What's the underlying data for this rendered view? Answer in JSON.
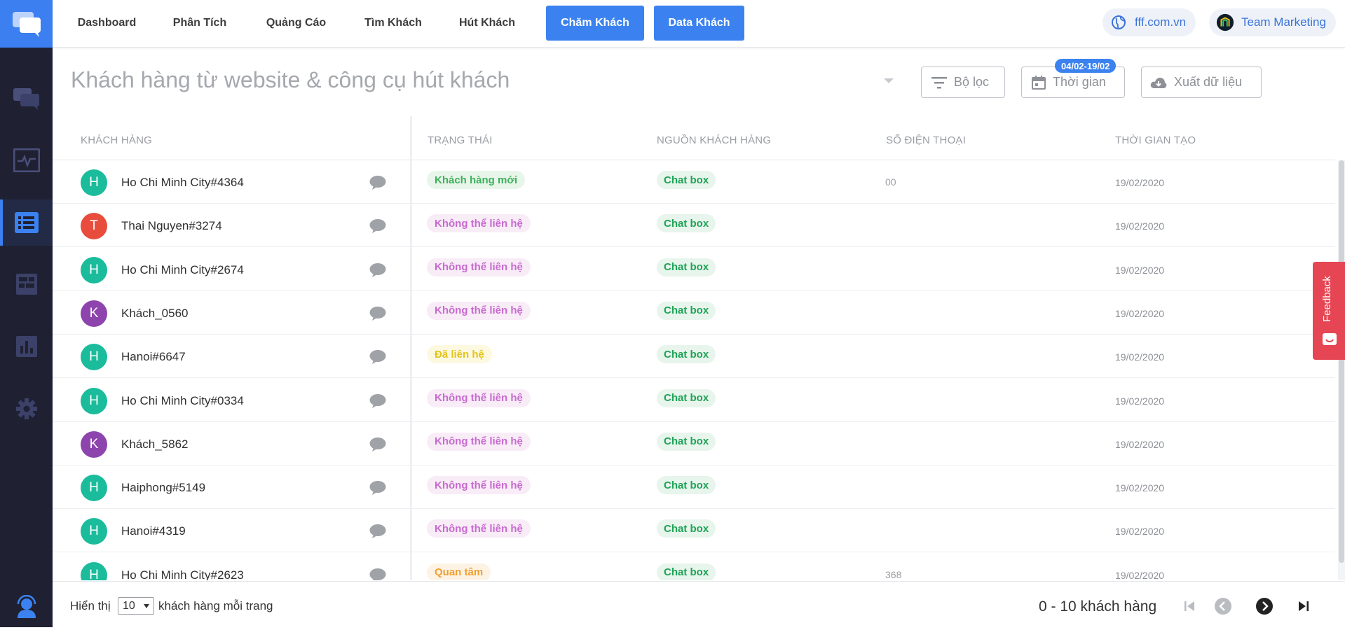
{
  "nav": {
    "tabs": [
      {
        "label": "Dashboard"
      },
      {
        "label": "Phân Tích"
      },
      {
        "label": "Quảng Cáo"
      },
      {
        "label": "Tìm Khách"
      },
      {
        "label": "Hút Khách"
      },
      {
        "label": "Chăm Khách"
      },
      {
        "label": "Data Khách"
      }
    ],
    "domain": "fff.com.vn",
    "team": "Team Marketing"
  },
  "sidebar": {
    "items": [
      {
        "icon": "chat-bubbles-icon"
      },
      {
        "icon": "activity-monitor-icon"
      },
      {
        "icon": "list-icon",
        "active": true
      },
      {
        "icon": "layout-icon"
      },
      {
        "icon": "bar-chart-icon"
      },
      {
        "icon": "gear-icon"
      }
    ],
    "bottom_icon": "support-agent-icon"
  },
  "header": {
    "title": "Khách hàng từ website & công cụ hút khách",
    "filter_label": "Bộ lọc",
    "time_label": "Thời gian",
    "date_range": "04/02-19/02",
    "export_label": "Xuất dữ liệu"
  },
  "table": {
    "columns": [
      "KHÁCH HÀNG",
      "TRẠNG THÁI",
      "NGUỒN KHÁCH HÀNG",
      "SỐ ĐIỆN THOẠI",
      "THỜI GIAN TẠO"
    ],
    "rows": [
      {
        "initial": "H",
        "avatar_color": "#1abc9c",
        "name": "Ho Chi Minh City#4364",
        "status": "Khách hàng mới",
        "status_type": "new",
        "source": "Chat box",
        "phone": "00",
        "created": "19/02/2020"
      },
      {
        "initial": "T",
        "avatar_color": "#e74c3c",
        "name": "Thai Nguyen#3274",
        "status": "Không thể liên hệ",
        "status_type": "unreachable",
        "source": "Chat box",
        "phone": "",
        "created": "19/02/2020"
      },
      {
        "initial": "H",
        "avatar_color": "#1abc9c",
        "name": "Ho Chi Minh City#2674",
        "status": "Không thể liên hệ",
        "status_type": "unreachable",
        "source": "Chat box",
        "phone": "",
        "created": "19/02/2020"
      },
      {
        "initial": "K",
        "avatar_color": "#8e44ad",
        "name": "Khách_0560",
        "status": "Không thể liên hệ",
        "status_type": "unreachable",
        "source": "Chat box",
        "phone": "",
        "created": "19/02/2020"
      },
      {
        "initial": "H",
        "avatar_color": "#1abc9c",
        "name": "Hanoi#6647",
        "status": "Đã liên hệ",
        "status_type": "contacted",
        "source": "Chat box",
        "phone": "",
        "created": "19/02/2020"
      },
      {
        "initial": "H",
        "avatar_color": "#1abc9c",
        "name": "Ho Chi Minh City#0334",
        "status": "Không thể liên hệ",
        "status_type": "unreachable",
        "source": "Chat box",
        "phone": "",
        "created": "19/02/2020"
      },
      {
        "initial": "K",
        "avatar_color": "#8e44ad",
        "name": "Khách_5862",
        "status": "Không thể liên hệ",
        "status_type": "unreachable",
        "source": "Chat box",
        "phone": "",
        "created": "19/02/2020"
      },
      {
        "initial": "H",
        "avatar_color": "#1abc9c",
        "name": "Haiphong#5149",
        "status": "Không thể liên hệ",
        "status_type": "unreachable",
        "source": "Chat box",
        "phone": "",
        "created": "19/02/2020"
      },
      {
        "initial": "H",
        "avatar_color": "#1abc9c",
        "name": "Hanoi#4319",
        "status": "Không thể liên hệ",
        "status_type": "unreachable",
        "source": "Chat box",
        "phone": "",
        "created": "19/02/2020"
      },
      {
        "initial": "H",
        "avatar_color": "#1abc9c",
        "name": "Ho Chi Minh City#2623",
        "status": "Quan tâm",
        "status_type": "interested",
        "source": "Chat box",
        "phone": "368",
        "created": "19/02/2020"
      }
    ]
  },
  "status_colors": {
    "new": {
      "bg": "#e8f6ea",
      "fg": "#3cb05a"
    },
    "unreachable": {
      "bg": "#f8ecf7",
      "fg": "#c86ad0"
    },
    "contacted": {
      "bg": "#fdf9e1",
      "fg": "#e3c41a"
    },
    "interested": {
      "bg": "#fdf3e4",
      "fg": "#f0a030"
    }
  },
  "feedback_label": "Feedback",
  "footer": {
    "show_label": "Hiển thị",
    "page_size": "10",
    "per_page_label": "khách hàng mỗi trang",
    "count_label": "0 - 10 khách hàng"
  },
  "colors": {
    "accent": "#3b82f0",
    "sidebar": "#1f2133"
  }
}
